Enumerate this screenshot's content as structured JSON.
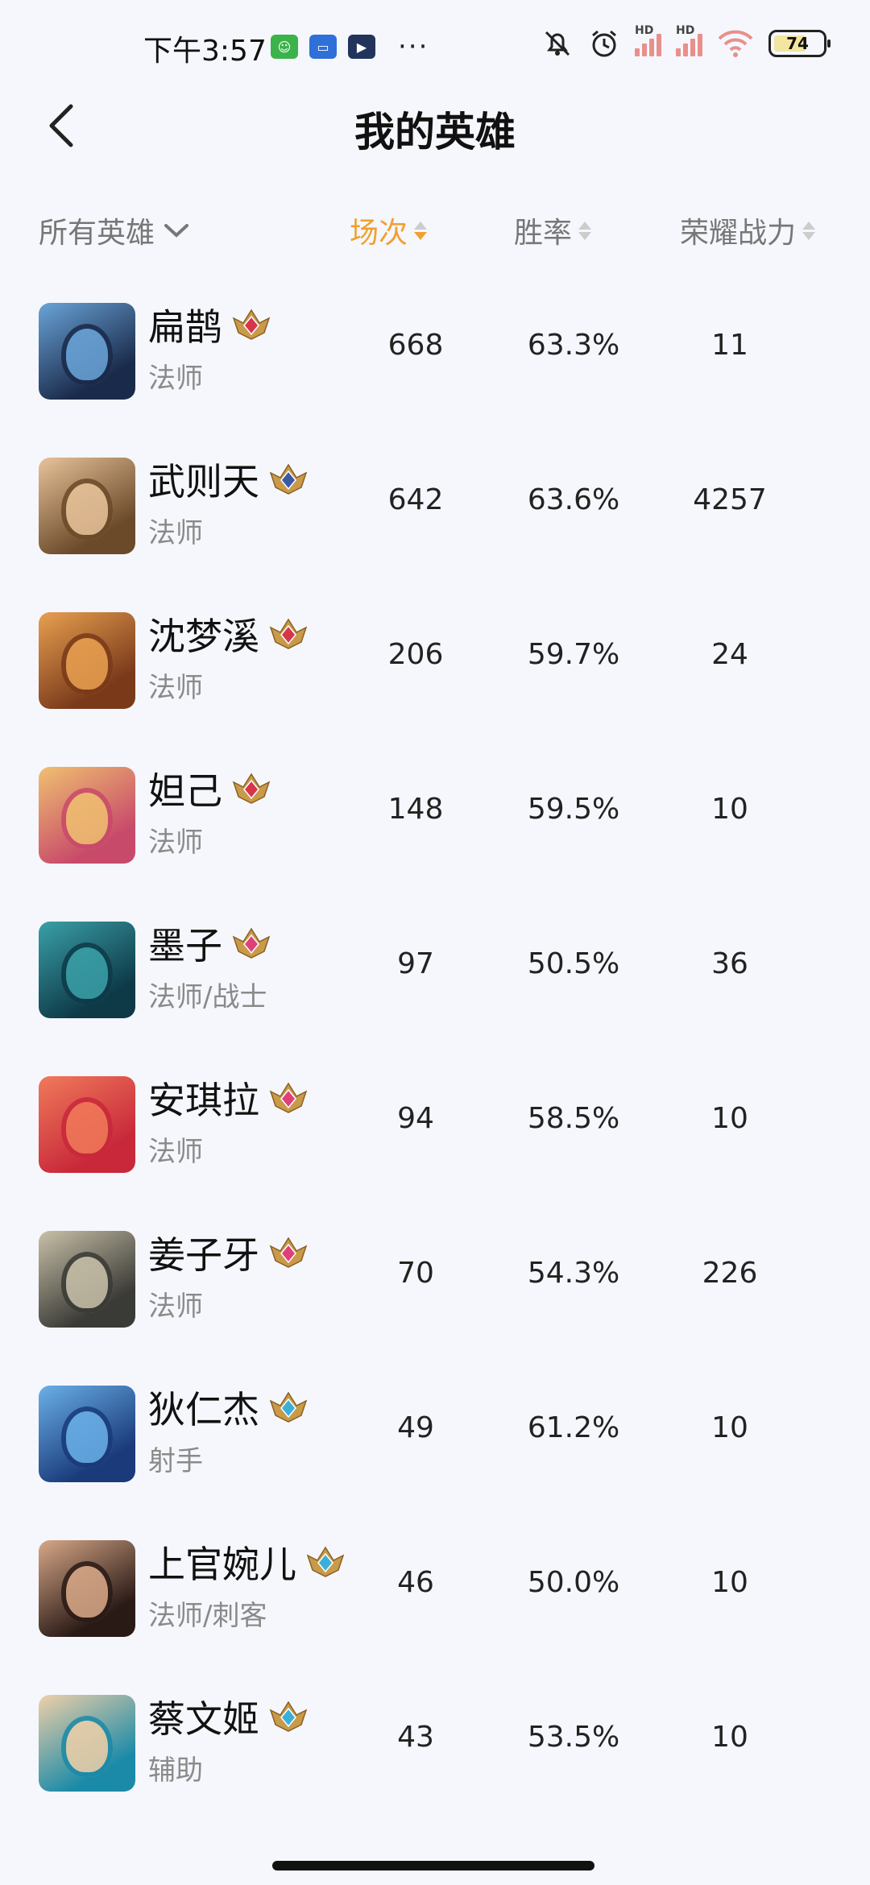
{
  "status_bar": {
    "time": "下午3:57",
    "more": "···",
    "battery": "74"
  },
  "header": {
    "title": "我的英雄"
  },
  "columns": {
    "filter_label": "所有英雄",
    "games": "场次",
    "win_rate": "胜率",
    "power": "荣耀战力"
  },
  "heroes": [
    {
      "name": "扁鹊",
      "role": "法师",
      "games": "668",
      "win_rate": "63.3%",
      "power": "11",
      "badge": "red",
      "colors": [
        "#1a2a4a",
        "#6aa4d8"
      ]
    },
    {
      "name": "武则天",
      "role": "法师",
      "games": "642",
      "win_rate": "63.6%",
      "power": "4257",
      "badge": "blue",
      "colors": [
        "#6b4a2a",
        "#e8c39a"
      ]
    },
    {
      "name": "沈梦溪",
      "role": "法师",
      "games": "206",
      "win_rate": "59.7%",
      "power": "24",
      "badge": "red",
      "colors": [
        "#7a3a1a",
        "#e8a050"
      ]
    },
    {
      "name": "妲己",
      "role": "法师",
      "games": "148",
      "win_rate": "59.5%",
      "power": "10",
      "badge": "red",
      "colors": [
        "#c84a6a",
        "#f0c070"
      ]
    },
    {
      "name": "墨子",
      "role": "法师/战士",
      "games": "97",
      "win_rate": "50.5%",
      "power": "36",
      "badge": "pink",
      "colors": [
        "#0e3a48",
        "#3aa0a8"
      ]
    },
    {
      "name": "安琪拉",
      "role": "法师",
      "games": "94",
      "win_rate": "58.5%",
      "power": "10",
      "badge": "pink",
      "colors": [
        "#c8283a",
        "#f07a5a"
      ]
    },
    {
      "name": "姜子牙",
      "role": "法师",
      "games": "70",
      "win_rate": "54.3%",
      "power": "226",
      "badge": "pink",
      "colors": [
        "#3a3a36",
        "#c8c0a8"
      ]
    },
    {
      "name": "狄仁杰",
      "role": "射手",
      "games": "49",
      "win_rate": "61.2%",
      "power": "10",
      "badge": "cyan",
      "colors": [
        "#1a3a7a",
        "#6ab0e8"
      ]
    },
    {
      "name": "上官婉儿",
      "role": "法师/刺客",
      "games": "46",
      "win_rate": "50.0%",
      "power": "10",
      "badge": "cyan",
      "colors": [
        "#2a1a16",
        "#d8a888"
      ]
    },
    {
      "name": "蔡文姬",
      "role": "辅助",
      "games": "43",
      "win_rate": "53.5%",
      "power": "10",
      "badge": "cyan",
      "colors": [
        "#1a8aa8",
        "#f0d0a8"
      ]
    }
  ],
  "badge_colors": {
    "red": "#d8354a",
    "blue": "#3a5aa8",
    "pink": "#e0407a",
    "cyan": "#3ab0d8",
    "frame": "#c89a4a"
  }
}
